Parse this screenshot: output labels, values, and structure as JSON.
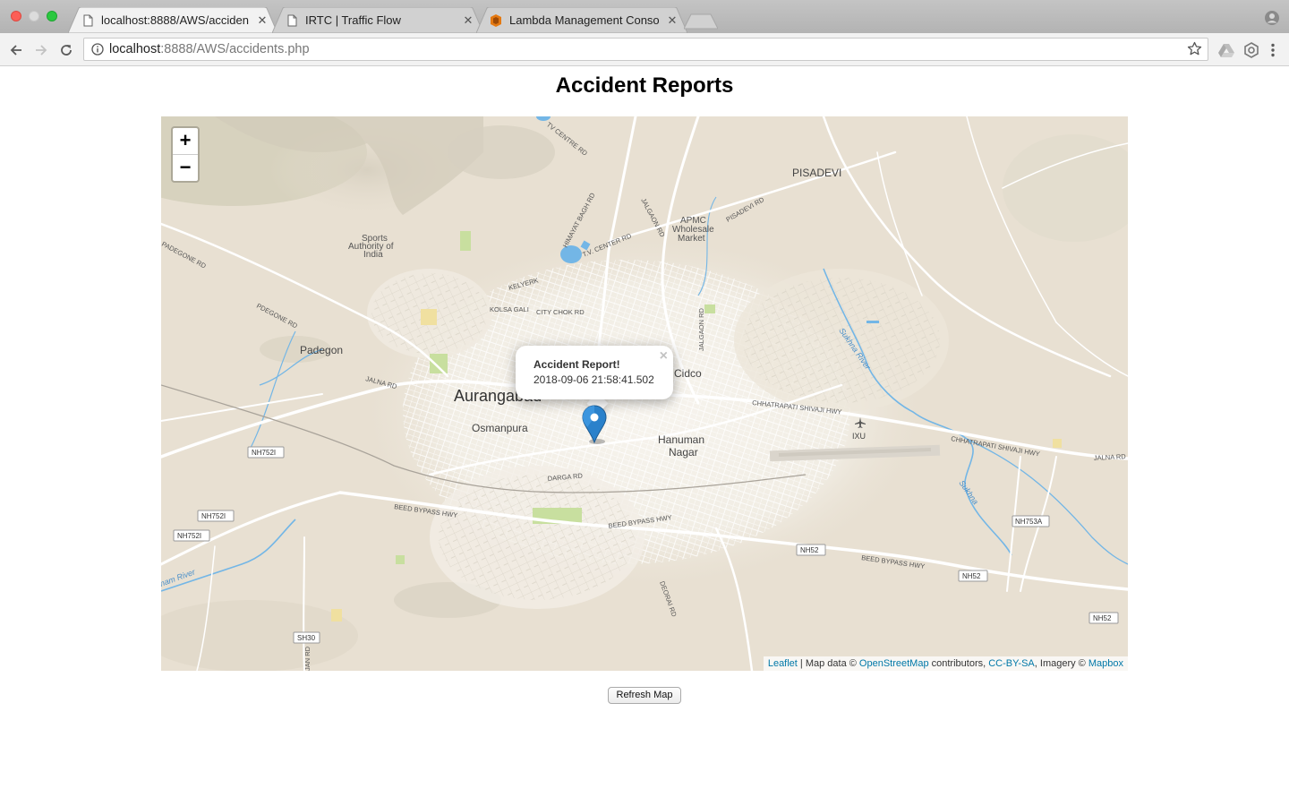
{
  "browser": {
    "tabs": [
      {
        "title": "localhost:8888/AWS/accidents",
        "active": true
      },
      {
        "title": "IRTC | Traffic Flow",
        "active": false
      },
      {
        "title": "Lambda Management Console",
        "active": false
      }
    ],
    "url_host": "localhost",
    "url_rest": ":8888/AWS/accidents.php"
  },
  "page": {
    "title": "Accident Reports",
    "refresh_label": "Refresh Map"
  },
  "map": {
    "zoom_in_label": "+",
    "zoom_out_label": "−",
    "popup": {
      "title": "Accident Report!",
      "timestamp": "2018-09-06 21:58:41.502",
      "close": "×"
    },
    "attribution": {
      "leaflet": "Leaflet",
      "sep1": " | Map data © ",
      "osm": "OpenStreetMap",
      "sep2": " contributors, ",
      "license": "CC-BY-SA",
      "sep3": ", Imagery © ",
      "mapbox": "Mapbox"
    },
    "labels": {
      "city": "Aurangabad",
      "pisadevi": "PISADEVI",
      "padegon": "Padegon",
      "osmanpura": "Osmanpura",
      "cidco": "Cidco",
      "hanuman1": "Hanuman",
      "hanuman2": "Nagar",
      "ixu": "IXU",
      "sports1": "Sports",
      "sports2": "Authority of",
      "sports3": "India",
      "apmc1": "APMC",
      "apmc2": "Wholesale",
      "apmc3": "Market",
      "tv_centre_rd": "TV CENTRE RD",
      "himayat_bagh_rd": "HIMAYAT BAGH RD",
      "jalgaon_rd": "JALGAON RD",
      "jalgaon_rd2": "JALGAON RD",
      "tv_center_rd": "T.V. CENTER RD",
      "pisadevi_rd": "PISADEVI RD",
      "kelyerk": "KELYERK",
      "kolsa": "KOLSA GALI",
      "city_chok": "CITY CHOK RD",
      "padegone_rd": "PADEGONE RD",
      "padegone_rd2": "PDEGONE RD",
      "jalna_rd": "JALNA RD",
      "jalna_rd2": "JALNA RD",
      "chhatrapati1": "CHHATRAPATI SHIVAJI HWY",
      "chhatrapati2": "CHHATRAPATI SHIVAJI HWY",
      "darga_rd": "DARGA RD",
      "beed_bypass1": "BEED BYPASS HWY",
      "beed_bypass2": "BEED BYPASS HWY",
      "beed_bypass3": "BEED BYPASS HWY",
      "deorai_rd": "DEORAI RD",
      "sukhna_river": "Sukhna River",
      "sukhna": "Sukhna",
      "kham_river": "ham River",
      "nh752i_a": "NH752I",
      "nh752i_b": "NH752I",
      "nh752i_c": "NH752I",
      "nh753a": "NH753A",
      "nh52_a": "NH52",
      "nh52_b": "NH52",
      "nh52_c": "NH52",
      "sh30": "SH30",
      "jan_rd": "JAN RD"
    }
  },
  "colors": {
    "map_bg": "#e8e0d2",
    "water": "#73b6e6",
    "park": "#c8df9f",
    "marker": "#2a81cb",
    "link": "#0078a8"
  }
}
